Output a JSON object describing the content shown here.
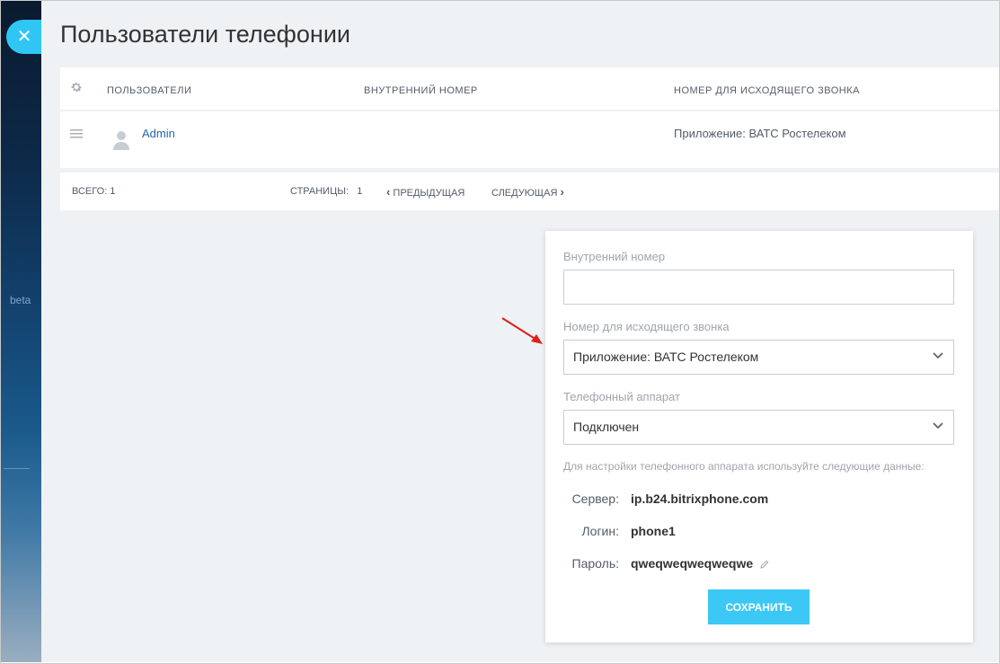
{
  "window": {
    "title": "Пользователи телефонии",
    "close_icon": "close-icon",
    "beta_label": "beta"
  },
  "grid": {
    "columns": [
      "ПОЛЬЗОВАТЕЛИ",
      "ВНУТРЕННИЙ НОМЕР",
      "НОМЕР ДЛЯ ИСХОДЯЩЕГО ЗВОНКА"
    ],
    "rows": [
      {
        "user": "Admin",
        "extension": "",
        "outgoing": "Приложение: ВАТС Ростелеком"
      }
    ],
    "footer": {
      "total_label": "ВСЕГО: 1",
      "pages_label": "СТРАНИЦЫ:",
      "page_number": "1",
      "prev_label": "ПРЕДЫДУЩАЯ",
      "next_label": "СЛЕДУЮЩАЯ"
    }
  },
  "form": {
    "extension_label": "Внутренний номер",
    "extension_value": "",
    "outgoing_label": "Номер для исходящего звонка",
    "outgoing_value": "Приложение: ВАТС Ростелеком",
    "device_label": "Телефонный аппарат",
    "device_value": "Подключен",
    "hint": "Для настройки телефонного аппарата используйте следующие данные:",
    "server_label": "Сервер:",
    "server_value": "ip.b24.bitrixphone.com",
    "login_label": "Логин:",
    "login_value": "phone1",
    "password_label": "Пароль:",
    "password_value": "qweqweqweqweqwe",
    "save_label": "СОХРАНИТЬ"
  },
  "colors": {
    "accent": "#3bc8f5",
    "link": "#2067b0",
    "background": "#eef2f4",
    "arrow": "#e02020"
  }
}
